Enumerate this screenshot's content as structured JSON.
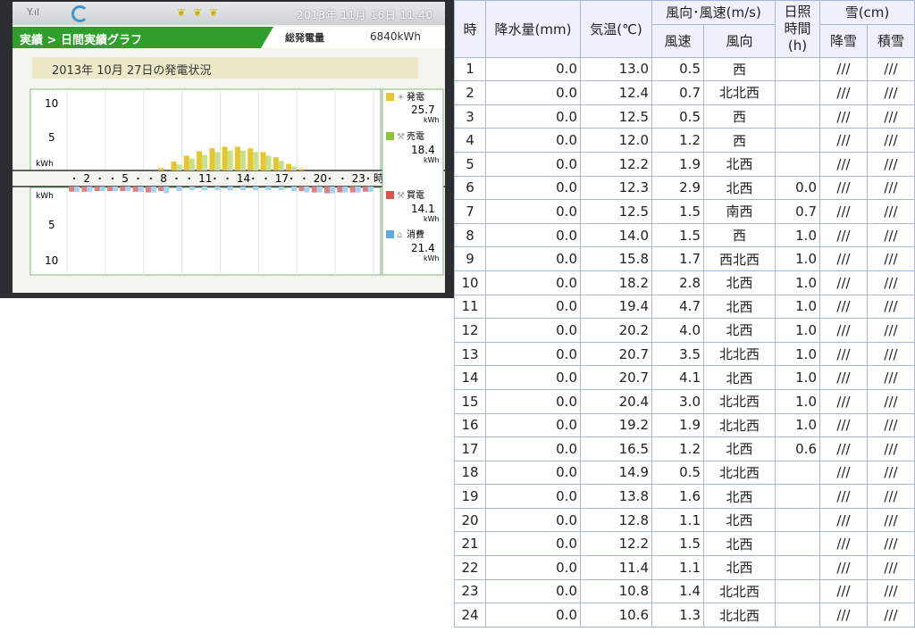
{
  "device": {
    "status_date": "2013年 11月 16日  11:40",
    "breadcrumb": "実績 > 日間実績グラフ",
    "total_label": "総発電量",
    "total_value": "6840kWh",
    "date_heading": "2013年 10月 27日の発電状況",
    "y_upper_ticks": [
      "10",
      "5"
    ],
    "y_lower_ticks": [
      "5",
      "10"
    ],
    "kwh_label": "kWh",
    "x_ticks": [
      "2",
      "5",
      "8",
      "11",
      "14",
      "17",
      "20",
      "23"
    ],
    "x_unit": "時",
    "legend": [
      {
        "label": "発電",
        "value": "25.7",
        "unit": "kWh",
        "color": "#e6c62a"
      },
      {
        "label": "売電",
        "value": "18.4",
        "unit": "kWh",
        "color": "#8cc63f"
      },
      {
        "label": "買電",
        "value": "14.1",
        "unit": "kWh",
        "color": "#d9534f"
      },
      {
        "label": "消費",
        "value": "21.4",
        "unit": "kWh",
        "color": "#5aa9e0"
      }
    ],
    "colors": {
      "nav_green": "#2f9f2b",
      "generation": "#e6c62a",
      "sold": "#c8e08c",
      "bought": "#d98080",
      "consumption": "#a8d0f0"
    }
  },
  "chart_data": {
    "type": "bar",
    "categories": [
      "1",
      "2",
      "3",
      "4",
      "5",
      "6",
      "7",
      "8",
      "9",
      "10",
      "11",
      "12",
      "13",
      "14",
      "15",
      "16",
      "17",
      "18",
      "19",
      "20",
      "21",
      "22",
      "23",
      "24"
    ],
    "series": [
      {
        "name": "発電",
        "values": [
          0,
          0,
          0,
          0,
          0,
          0,
          0,
          0.3,
          1.2,
          2.0,
          2.6,
          3.0,
          3.2,
          3.2,
          3.0,
          2.5,
          1.8,
          0.9,
          0.2,
          0,
          0,
          0,
          0,
          0
        ]
      },
      {
        "name": "売電",
        "values": [
          0,
          0,
          0,
          0,
          0,
          0,
          0,
          0,
          0.8,
          1.6,
          2.1,
          2.5,
          2.7,
          2.7,
          2.5,
          2.0,
          1.3,
          0.5,
          0,
          0,
          0,
          0,
          0,
          0
        ]
      },
      {
        "name": "買電",
        "values": [
          0.7,
          0.7,
          0.6,
          0.6,
          0.6,
          0.7,
          0.8,
          0.6,
          0,
          0,
          0,
          0,
          0,
          0,
          0,
          0,
          0,
          0,
          0.6,
          0.8,
          0.9,
          0.8,
          0.8,
          0.7
        ]
      },
      {
        "name": "消費",
        "values": [
          0.7,
          0.7,
          0.6,
          0.6,
          0.6,
          0.7,
          0.8,
          0.9,
          0.6,
          0.5,
          0.5,
          0.5,
          0.5,
          0.5,
          0.5,
          0.5,
          0.5,
          0.6,
          0.8,
          0.8,
          0.9,
          0.8,
          0.8,
          0.7
        ]
      }
    ],
    "ylim": [
      0,
      10
    ]
  },
  "weather": {
    "header": {
      "hour": "時",
      "precip": "降水量(mm)",
      "temp": "気温(℃)",
      "wind": "風向･風速(m/s)",
      "wind_speed": "風速",
      "wind_dir": "風向",
      "sunshine": "日照時間(h)",
      "snow": "雪(cm)",
      "snowfall": "降雪",
      "snow_depth": "積雪"
    },
    "rows": [
      {
        "hour": "1",
        "precip": "0.0",
        "temp": "13.0",
        "speed": "0.5",
        "dir": "西",
        "sun": "",
        "snowfall": "///",
        "depth": "///"
      },
      {
        "hour": "2",
        "precip": "0.0",
        "temp": "12.4",
        "speed": "0.7",
        "dir": "北北西",
        "sun": "",
        "snowfall": "///",
        "depth": "///"
      },
      {
        "hour": "3",
        "precip": "0.0",
        "temp": "12.5",
        "speed": "0.5",
        "dir": "西",
        "sun": "",
        "snowfall": "///",
        "depth": "///"
      },
      {
        "hour": "4",
        "precip": "0.0",
        "temp": "12.0",
        "speed": "1.2",
        "dir": "西",
        "sun": "",
        "snowfall": "///",
        "depth": "///"
      },
      {
        "hour": "5",
        "precip": "0.0",
        "temp": "12.2",
        "speed": "1.9",
        "dir": "北西",
        "sun": "",
        "snowfall": "///",
        "depth": "///"
      },
      {
        "hour": "6",
        "precip": "0.0",
        "temp": "12.3",
        "speed": "2.9",
        "dir": "北西",
        "sun": "0.0",
        "snowfall": "///",
        "depth": "///"
      },
      {
        "hour": "7",
        "precip": "0.0",
        "temp": "12.5",
        "speed": "1.5",
        "dir": "南西",
        "sun": "0.7",
        "snowfall": "///",
        "depth": "///"
      },
      {
        "hour": "8",
        "precip": "0.0",
        "temp": "14.0",
        "speed": "1.5",
        "dir": "西",
        "sun": "1.0",
        "snowfall": "///",
        "depth": "///"
      },
      {
        "hour": "9",
        "precip": "0.0",
        "temp": "15.8",
        "speed": "1.7",
        "dir": "西北西",
        "sun": "1.0",
        "snowfall": "///",
        "depth": "///"
      },
      {
        "hour": "10",
        "precip": "0.0",
        "temp": "18.2",
        "speed": "2.8",
        "dir": "北西",
        "sun": "1.0",
        "snowfall": "///",
        "depth": "///"
      },
      {
        "hour": "11",
        "precip": "0.0",
        "temp": "19.4",
        "speed": "4.7",
        "dir": "北西",
        "sun": "1.0",
        "snowfall": "///",
        "depth": "///"
      },
      {
        "hour": "12",
        "precip": "0.0",
        "temp": "20.2",
        "speed": "4.0",
        "dir": "北西",
        "sun": "1.0",
        "snowfall": "///",
        "depth": "///"
      },
      {
        "hour": "13",
        "precip": "0.0",
        "temp": "20.7",
        "speed": "3.5",
        "dir": "北北西",
        "sun": "1.0",
        "snowfall": "///",
        "depth": "///"
      },
      {
        "hour": "14",
        "precip": "0.0",
        "temp": "20.7",
        "speed": "4.1",
        "dir": "北西",
        "sun": "1.0",
        "snowfall": "///",
        "depth": "///"
      },
      {
        "hour": "15",
        "precip": "0.0",
        "temp": "20.4",
        "speed": "3.0",
        "dir": "北北西",
        "sun": "1.0",
        "snowfall": "///",
        "depth": "///"
      },
      {
        "hour": "16",
        "precip": "0.0",
        "temp": "19.2",
        "speed": "1.9",
        "dir": "北北西",
        "sun": "1.0",
        "snowfall": "///",
        "depth": "///"
      },
      {
        "hour": "17",
        "precip": "0.0",
        "temp": "16.5",
        "speed": "1.2",
        "dir": "北西",
        "sun": "0.6",
        "snowfall": "///",
        "depth": "///"
      },
      {
        "hour": "18",
        "precip": "0.0",
        "temp": "14.9",
        "speed": "0.5",
        "dir": "北北西",
        "sun": "",
        "snowfall": "///",
        "depth": "///"
      },
      {
        "hour": "19",
        "precip": "0.0",
        "temp": "13.8",
        "speed": "1.6",
        "dir": "北西",
        "sun": "",
        "snowfall": "///",
        "depth": "///"
      },
      {
        "hour": "20",
        "precip": "0.0",
        "temp": "12.8",
        "speed": "1.1",
        "dir": "北西",
        "sun": "",
        "snowfall": "///",
        "depth": "///"
      },
      {
        "hour": "21",
        "precip": "0.0",
        "temp": "12.2",
        "speed": "1.5",
        "dir": "北西",
        "sun": "",
        "snowfall": "///",
        "depth": "///"
      },
      {
        "hour": "22",
        "precip": "0.0",
        "temp": "11.4",
        "speed": "1.1",
        "dir": "北西",
        "sun": "",
        "snowfall": "///",
        "depth": "///"
      },
      {
        "hour": "23",
        "precip": "0.0",
        "temp": "10.8",
        "speed": "1.4",
        "dir": "北北西",
        "sun": "",
        "snowfall": "///",
        "depth": "///"
      },
      {
        "hour": "24",
        "precip": "0.0",
        "temp": "10.6",
        "speed": "1.3",
        "dir": "北北西",
        "sun": "",
        "snowfall": "///",
        "depth": "///"
      }
    ]
  }
}
